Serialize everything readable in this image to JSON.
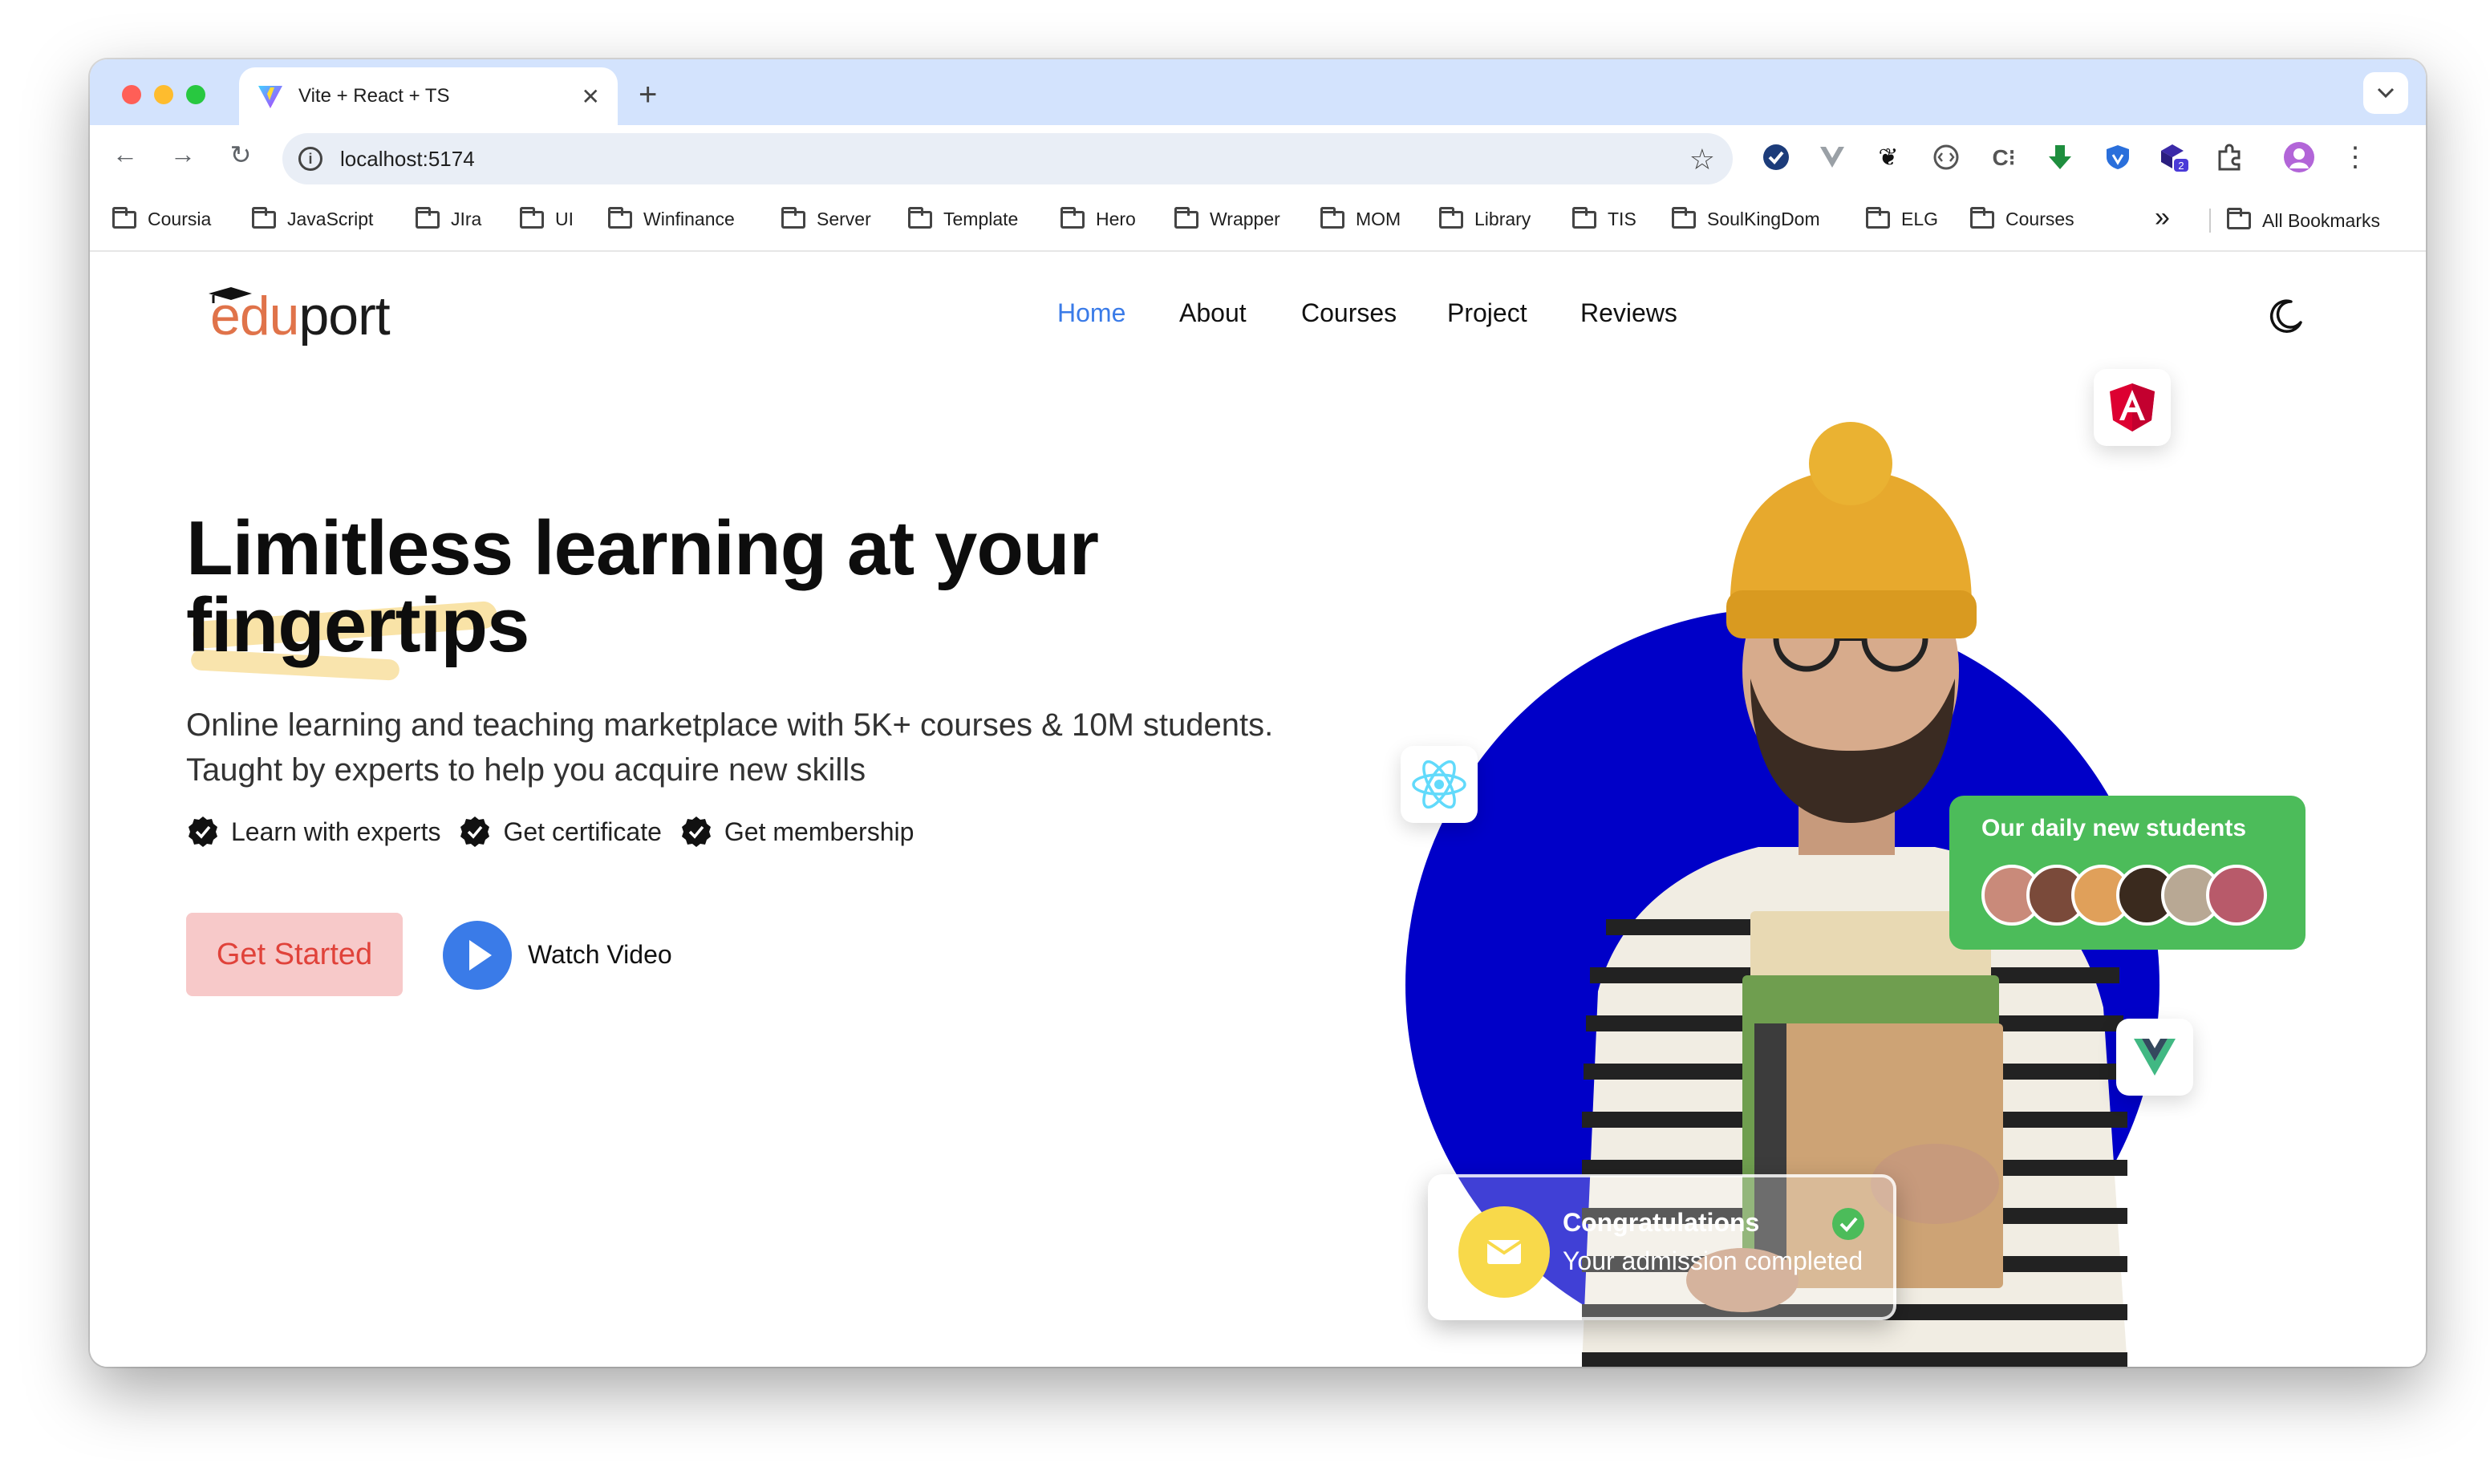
{
  "browser": {
    "tab_title": "Vite + React + TS",
    "tab_close": "✕",
    "new_tab": "+",
    "url": "localhost:5174",
    "bookmarks": [
      "Coursia",
      "JavaScript",
      "JIra",
      "UI",
      "Winfinance",
      "Server",
      "Template",
      "Hero",
      "Wrapper",
      "MOM",
      "Library",
      "TIS",
      "SoulKingDom",
      "ELG",
      "Courses"
    ],
    "more_bookmarks": "»",
    "all_bookmarks": "All Bookmarks",
    "extension_badge": "2"
  },
  "site": {
    "logo_edu": "edu",
    "logo_port": "port",
    "nav": [
      "Home",
      "About",
      "Courses",
      "Project",
      "Reviews"
    ],
    "active_nav": "Home",
    "hero_title_line1": "Limitless learning at your",
    "hero_title_line2": "fingertips",
    "hero_subtitle": "Online learning and teaching marketplace with 5K+ courses & 10M students. Taught by experts to help you acquire new skills",
    "features": [
      "Learn with experts",
      "Get certificate",
      "Get membership"
    ],
    "cta_primary": "Get Started",
    "cta_secondary": "Watch Video",
    "students_card_title": "Our daily new students",
    "congrats_title": "Congratulations",
    "congrats_text": "Your admission completed"
  },
  "colors": {
    "accent_blue": "#3a7be8",
    "circle_blue": "#0000c8",
    "students_green": "#4cbc5a",
    "cta_bg": "#f7c9c9",
    "cta_text": "#e0423a"
  },
  "icons": [
    "vite-favicon",
    "back-icon",
    "forward-icon",
    "reload-icon",
    "info-icon",
    "star-icon",
    "folder-icon",
    "moon-icon",
    "check-icon",
    "play-icon",
    "angular-icon",
    "react-icon",
    "vue-icon",
    "mail-icon"
  ]
}
